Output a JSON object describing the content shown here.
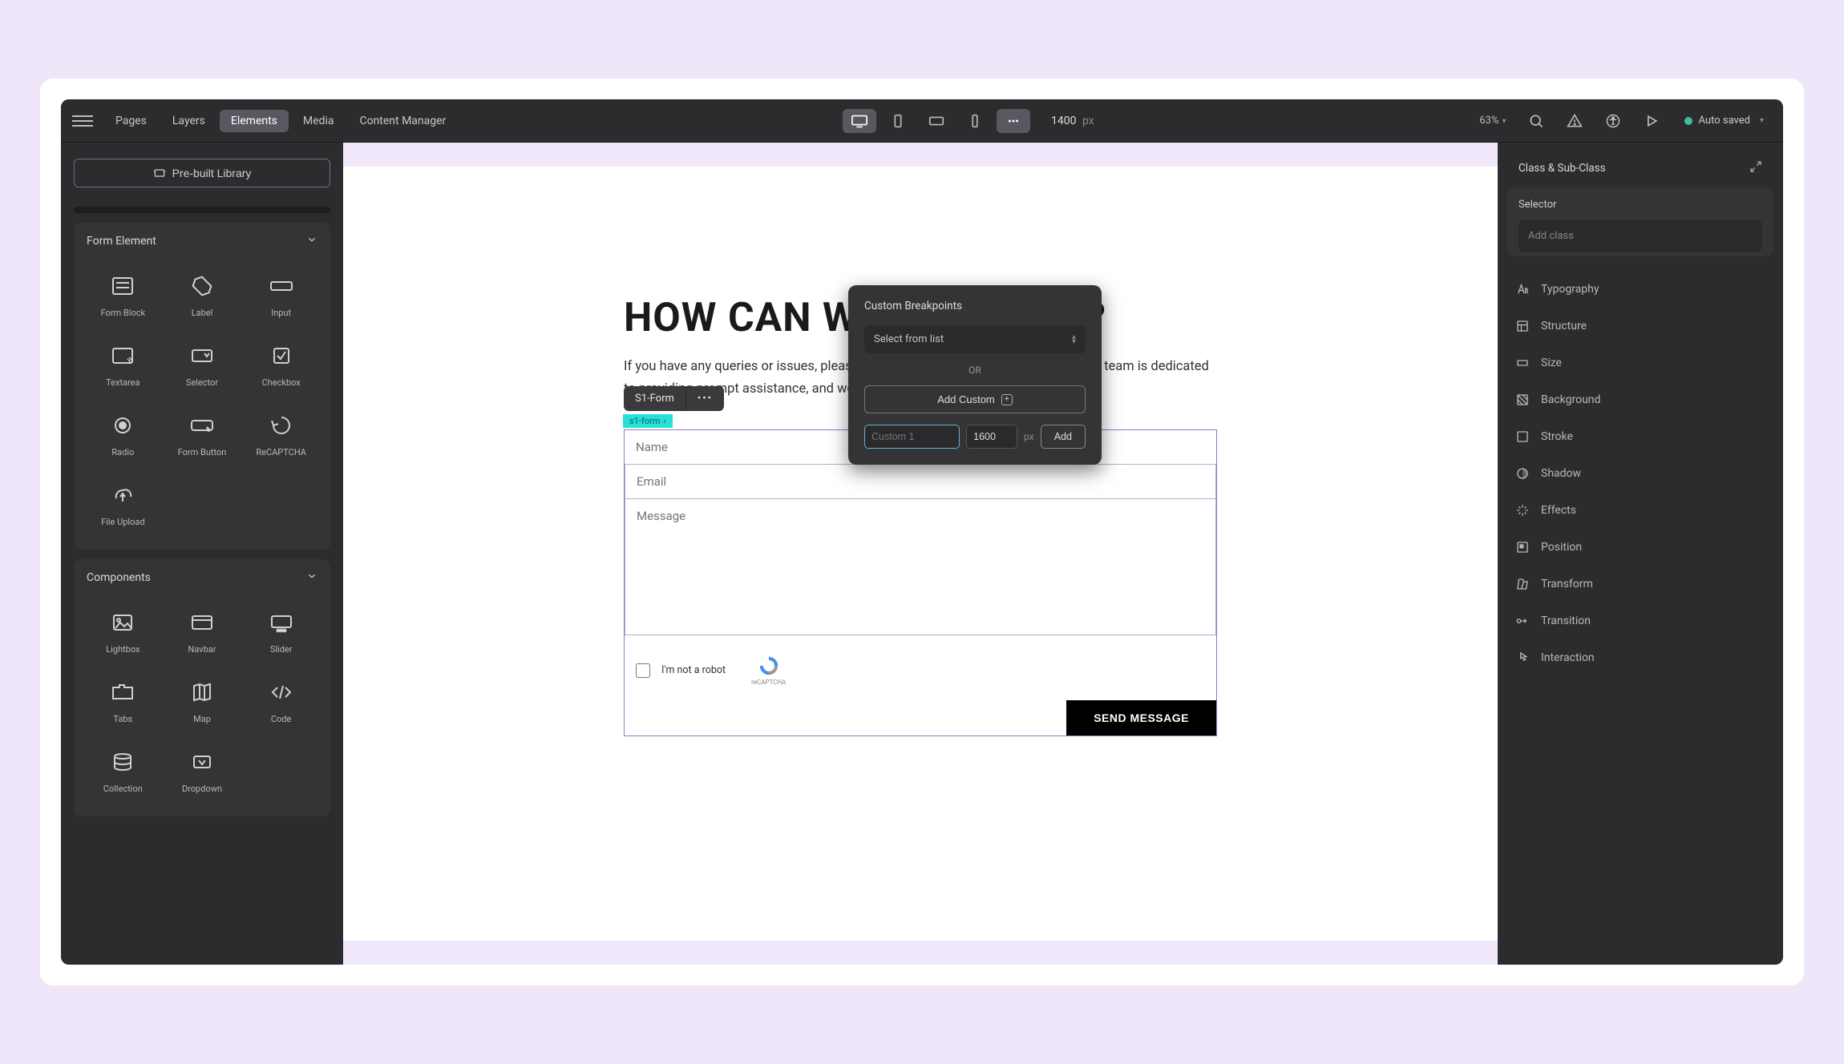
{
  "topbar": {
    "tabs": [
      "Pages",
      "Layers",
      "Elements",
      "Media",
      "Content Manager"
    ],
    "active_tab_index": 2,
    "width_value": "1400",
    "width_unit": "px",
    "zoom": "63%",
    "save_status": "Auto saved"
  },
  "left": {
    "library_btn": "Pre-built Library",
    "sections": {
      "form_elements": {
        "title": "Form Element",
        "items": [
          "Form Block",
          "Label",
          "Input",
          "Textarea",
          "Selector",
          "Checkbox",
          "Radio",
          "Form Button",
          "ReCAPTCHA",
          "File Upload"
        ]
      },
      "components": {
        "title": "Components",
        "items": [
          "Lightbox",
          "Navbar",
          "Slider",
          "Tabs",
          "Map",
          "Code",
          "Collection",
          "Dropdown"
        ]
      }
    }
  },
  "popover": {
    "title": "Custom Breakpoints",
    "select_placeholder": "Select from list",
    "or_text": "OR",
    "add_custom": "Add Custom",
    "name_placeholder": "Custom 1",
    "width_value": "1600",
    "width_unit": "px",
    "add_btn": "Add"
  },
  "canvas": {
    "headline": "HOW CAN WE HELP YOU?",
    "subtext": "If you have any queries or issues, please don't hesitate to send us a message. Our team is dedicated to providing prompt assistance, and we will get back to you shortly.",
    "form_tag": "s1-form",
    "ctx_label": "S1-Form",
    "name_placeholder": "Name",
    "email_placeholder": "Email",
    "message_placeholder": "Message",
    "recaptcha_text": "I'm not a robot",
    "recaptcha_brand": "reCAPTCHA",
    "send_btn": "SEND MESSAGE"
  },
  "right": {
    "header": "Class & Sub-Class",
    "selector_label": "Selector",
    "add_class_placeholder": "Add class",
    "styles": [
      "Typography",
      "Structure",
      "Size",
      "Background",
      "Stroke",
      "Shadow",
      "Effects",
      "Position",
      "Transform",
      "Transition",
      "Interaction"
    ]
  }
}
